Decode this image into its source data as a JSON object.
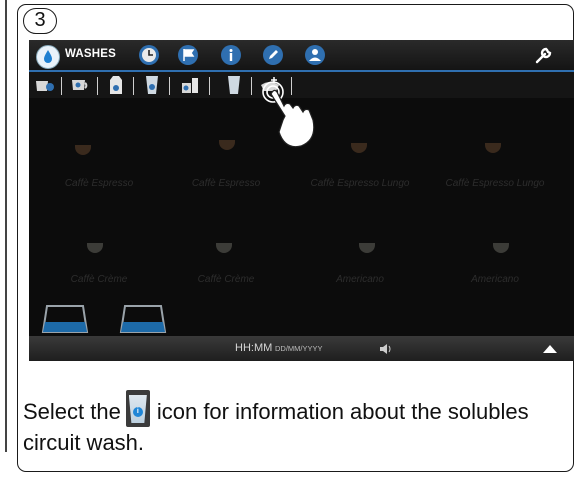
{
  "step_number": "3",
  "screen": {
    "active_tab_label": "WASHES",
    "top_icons": [
      "clock-icon",
      "flag-icon",
      "info-icon",
      "pencil-icon",
      "user-icon"
    ],
    "settings_icon": "wrench-icon",
    "wash_icons": [
      "milk-wash-icon",
      "cup-wash-icon",
      "milk-carton-icon",
      "glass-info-icon",
      "jug-milk-icon",
      "glass-icon",
      "solubles-wash-icon"
    ],
    "products": [
      "Caffè Espresso",
      "Caffè Espresso",
      "Caffè Espresso Lungo",
      "Caffè Espresso Lungo",
      "Caffè Crème",
      "Caffè Crème",
      "Americano",
      "Americano"
    ],
    "status": {
      "time": "HH:MM",
      "date": "DD/MM/YYYY"
    }
  },
  "caption": {
    "before": "Select the",
    "after": "icon for information about the solubles circuit wash."
  },
  "colors": {
    "accent": "#2f6fb0",
    "screen_bg": "#0c0c0c"
  }
}
